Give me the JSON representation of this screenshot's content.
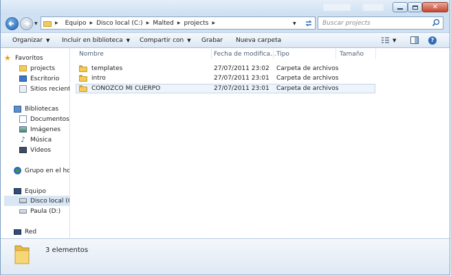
{
  "address_bar": {
    "crumbs": [
      "Equipo",
      "Disco local (C:)",
      "Malted",
      "projects"
    ],
    "search_placeholder": "Buscar projects"
  },
  "toolbar": {
    "organize": "Organizar",
    "include_library": "Incluir en biblioteca",
    "share_with": "Compartir con",
    "burn": "Grabar",
    "new_folder": "Nueva carpeta"
  },
  "nav": {
    "favorites_header": "Favoritos",
    "favorites": [
      "projects",
      "Escritorio",
      "Sitios recientes"
    ],
    "libraries_header": "Bibliotecas",
    "libraries": [
      "Documentos",
      "Imágenes",
      "Música",
      "Vídeos"
    ],
    "homegroup": "Grupo en el hogar",
    "computer_header": "Equipo",
    "computer": [
      "Disco local (C:)",
      "Paula (D:)"
    ],
    "network": "Red"
  },
  "columns": {
    "name": "Nombre",
    "date": "Fecha de modifica...",
    "type": "Tipo",
    "size": "Tamaño"
  },
  "files": [
    {
      "name": "templates",
      "date": "27/07/2011 23:02",
      "type": "Carpeta de archivos"
    },
    {
      "name": "intro",
      "date": "27/07/2011 23:01",
      "type": "Carpeta de archivos"
    },
    {
      "name": "CONOZCO MI CUERPO",
      "date": "27/07/2011 23:01",
      "type": "Carpeta de archivos"
    }
  ],
  "status": {
    "item_count": "3 elementos"
  }
}
